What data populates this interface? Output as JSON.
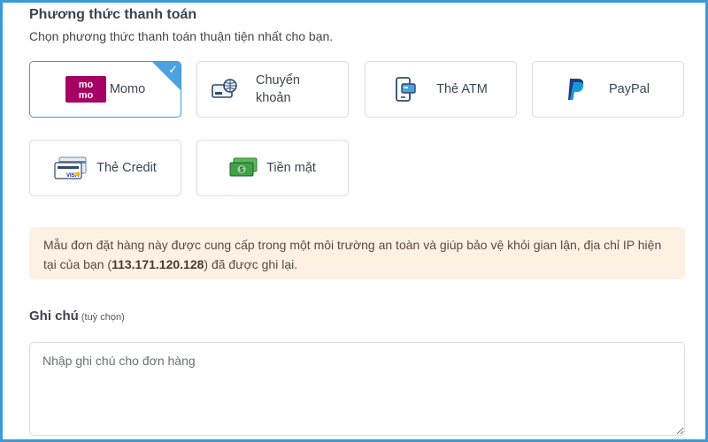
{
  "section": {
    "title": "Phương thức thanh toán",
    "subtitle": "Chọn phương thức thanh toán thuận tiện nhất cho bạn."
  },
  "methods": [
    {
      "label": "Momo",
      "icon": "momo-logo",
      "selected": true,
      "logo_text_top": "mo",
      "logo_text_bottom": "mo"
    },
    {
      "label": "Chuyển khoản",
      "icon": "bank-transfer-icon",
      "selected": false
    },
    {
      "label": "Thẻ ATM",
      "icon": "atm-card-icon",
      "selected": false
    },
    {
      "label": "PayPal",
      "icon": "paypal-icon",
      "selected": false
    },
    {
      "label": "Thẻ Credit",
      "icon": "credit-card-icon",
      "selected": false,
      "card_brand": "VISA"
    },
    {
      "label": "Tiền mặt",
      "icon": "cash-icon",
      "selected": false
    }
  ],
  "notice": {
    "text_before": "Mẫu đơn đặt hàng này được cung cấp trong một môi trường an toàn và giúp bảo vệ khỏi gian lận, địa chỉ IP hiện tại của bạn (",
    "ip": "113.171.120.128",
    "text_after": ") đã được ghi lại."
  },
  "note": {
    "label": "Ghi chú",
    "optional": "(tuỳ chọn)",
    "placeholder": "Nhập ghi chú cho đơn hàng",
    "value": ""
  },
  "colors": {
    "accent": "#3a9ad9",
    "momo": "#a50064",
    "notice_bg": "#fdf1e4"
  }
}
